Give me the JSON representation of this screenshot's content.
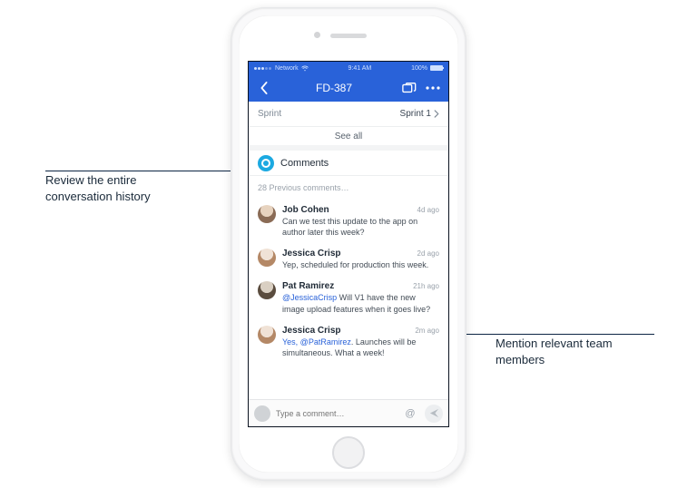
{
  "status_bar": {
    "carrier": "Network",
    "time": "9:41 AM",
    "battery": "100%"
  },
  "navbar": {
    "title": "FD-387"
  },
  "meta": {
    "label": "Sprint",
    "value": "Sprint 1"
  },
  "see_all": "See all",
  "comments_header": "Comments",
  "previous_comments": "28 Previous comments…",
  "comments": [
    {
      "name": "Job Cohen",
      "time": "4d ago",
      "text": "Can we test this update to the app on author later this week?",
      "mention": ""
    },
    {
      "name": "Jessica Crisp",
      "time": "2d ago",
      "text": "Yep, scheduled for production this week.",
      "mention": ""
    },
    {
      "name": "Pat Ramirez",
      "time": "21h ago",
      "text": " Will V1 have the new image upload features when it goes live?",
      "mention": "@JessicaCrisp"
    },
    {
      "name": "Jessica Crisp",
      "time": "2m ago",
      "text": ". Launches will be simultaneous. What a week!",
      "mention": "Yes, @PatRamirez"
    }
  ],
  "input": {
    "placeholder": "Type a comment…",
    "mention_symbol": "@"
  },
  "annotations": {
    "left": "Review the entire conversation history",
    "right": "Mention relevant team members"
  }
}
